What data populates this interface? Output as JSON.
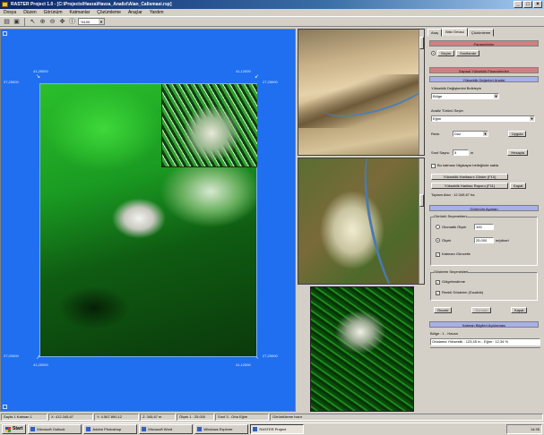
{
  "window": {
    "title": "RASTER Project 1.0 - [C:\\Projects\\Havza\\Havza_Analizi\\Alan_Calismasi.rsp]",
    "minimize": "_",
    "maximize": "□",
    "close": "×"
  },
  "menu": [
    "Dosya",
    "Düzen",
    "Görünüm",
    "Katmanlar",
    "Çözümleme",
    "Araçlar",
    "Yardım"
  ],
  "toolbar": {
    "zoom_value": "%100",
    "icons": [
      "folder-open-icon",
      "save-icon",
      "pointer-icon",
      "zoom-in-icon",
      "zoom-out-icon",
      "pan-icon",
      "identify-icon"
    ]
  },
  "map": {
    "coords_top": [
      "41,25000",
      "41,12000"
    ],
    "coords_left": [
      "27,25000",
      "27,20000"
    ],
    "coords_bottom": [
      "41,25000",
      "41,12000"
    ],
    "coords_right": [
      "27,25000",
      "27,20000"
    ]
  },
  "side": {
    "tabs": [
      "Araç",
      "Bitki Örtüsü",
      "Çözümleme"
    ],
    "header_red_1": "Parametreler",
    "mode_buttons": [
      "Seçim",
      "Sınıflandır"
    ],
    "header_red_2": "Sayısal Yükseklik Parametreleri",
    "header_blue_1": "Yükseklik Değerleri Analizi",
    "section_label_1": "Yükseklik Değişkenini Belirleyin",
    "select_1": "Bölge",
    "section_label_2": "Analiz Türünü Seçin",
    "select_2": "Eğim",
    "field_label_a": "Renk",
    "field_value_a": "Düz",
    "button_apply": "Uygula",
    "field_label_b": "Sınıf Sayısı",
    "field_value_b": "5",
    "field_unit_b": "m",
    "button_calc": "Hesapla",
    "checkbox_1": "Bu katmanı bilgisayar belleğinde sakla",
    "button_wide_1": "Yükseklik Haritasını Göster (F10)",
    "button_wide_2": "Yükseklik Haritası Raporu (F11)",
    "button_close": "Kapat",
    "info_line": "Toplam Alan : 12.345,67 ha",
    "header_blue_2": "Görünüm Ayarları",
    "group_title_1": "Görüntü Seçenekleri",
    "radio_1": "Otomatik Ölçek",
    "radio_1_value": "100",
    "radio_2": "Ölçek",
    "radio_2_value": "25.000",
    "radio_2_unit": "m/piksel",
    "checkbox_2": "Katmanı Güncelle",
    "group_title_2": "Gösterim Seçenekleri",
    "checkbox_3": "Gölgelendirme",
    "checkbox_4": "Renkli Gösterim (Sıcaklık)",
    "footer_buttons": [
      "Önceki",
      "Sonraki",
      "Kapat"
    ],
    "header_blue_3": "Katman Bilgileri Açıklaması",
    "list_line_1": "Bölge : 1 - Havza",
    "list_line_2": "Ortalama Yükseklik : 123,45 m - Eğim : 12,34 %"
  },
  "status": [
    "Sayfa 1 Katman 1",
    "X: 412.345,67",
    "Y: 4.567.890,12",
    "Z: 345,67 m",
    "Ölçek 1 : 25.000",
    "Sınıf 3 - Orta Eğim",
    "Görüntüleme hazır"
  ],
  "taskbar": {
    "start": "Start",
    "tasks": [
      "Microsoft Outlook",
      "Adobe Photoshop",
      "Microsoft Word",
      "Windows Explorer",
      "RASTER Project"
    ],
    "clock": "14:35"
  }
}
